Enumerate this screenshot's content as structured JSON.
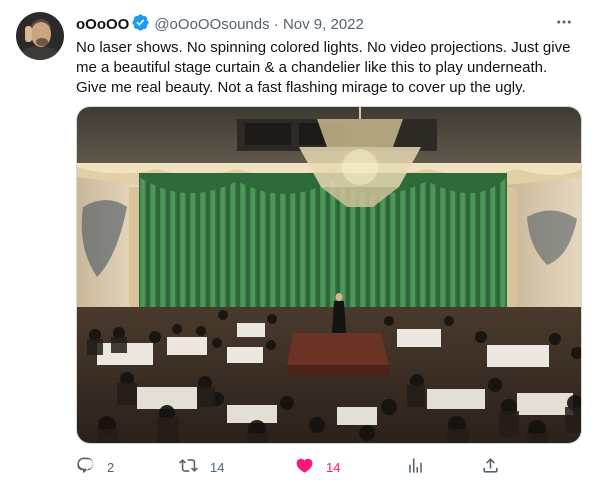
{
  "author": {
    "display_name": "oOoOO",
    "handle": "@oOoOOsounds",
    "separator": "·",
    "date": "Nov 9, 2022",
    "verified": true,
    "verified_color": "#1d9bf0"
  },
  "tweet": {
    "lines": [
      "No laser shows. No spinning colored lights. No video projections. Just give",
      "me a beautiful stage curtain & a chandelier like this to play underneath.",
      "Give me real beauty.  Not a fast flashing mirage to cover up the ugly."
    ]
  },
  "actions": {
    "reply_count": "2",
    "retweet_count": "14",
    "like_count": "14",
    "liked": true,
    "like_color": "#f91880",
    "icons": [
      "reply-icon",
      "retweet-icon",
      "heart-icon",
      "views-icon",
      "share-icon"
    ]
  },
  "more_icon": "more-icon"
}
